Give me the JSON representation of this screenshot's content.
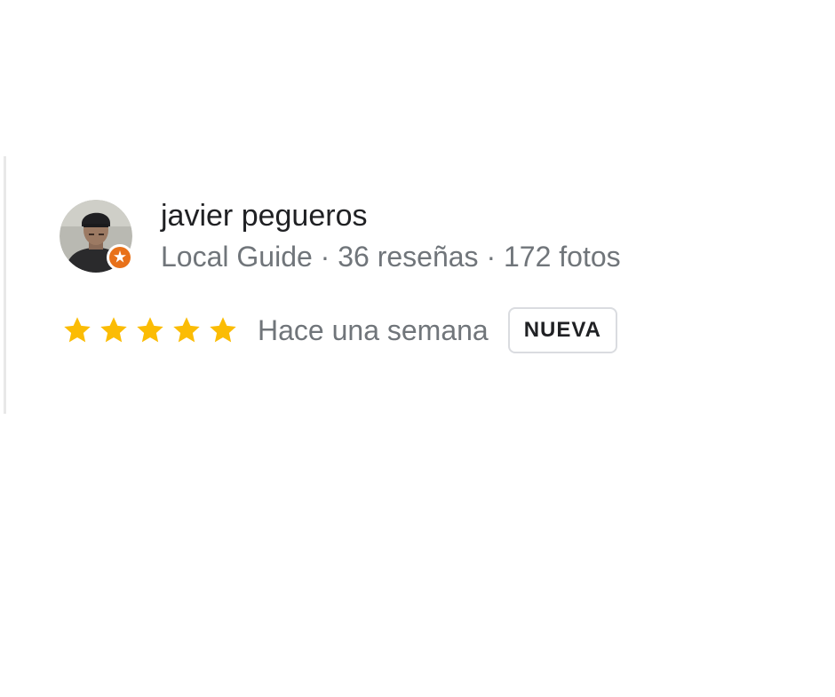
{
  "review": {
    "reviewer": {
      "name": "javier pegueros",
      "meta": "Local Guide · 36 reseñas · 172 fotos",
      "avatar_icon": "user-photo",
      "badge_icon": "local-guide-badge-icon"
    },
    "rating": {
      "value": 5,
      "max": 5,
      "star_color": "#fbbc04"
    },
    "date": "Hace una semana",
    "badge_label": "NUEVA"
  }
}
